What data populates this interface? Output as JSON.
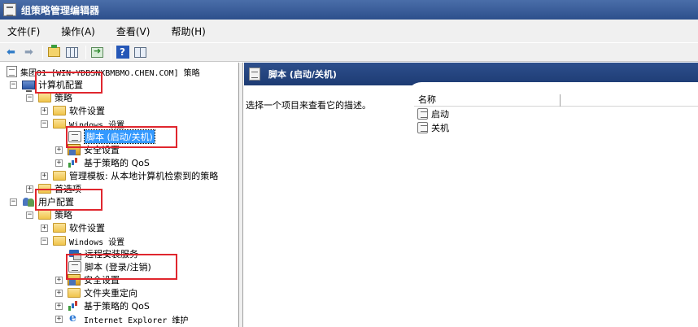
{
  "window": {
    "title": "组策略管理编辑器"
  },
  "menu": [
    {
      "label": "文件(F)"
    },
    {
      "label": "操作(A)"
    },
    {
      "label": "查看(V)"
    },
    {
      "label": "帮助(H)"
    }
  ],
  "toolbar": {
    "buttons": [
      "back-icon",
      "forward-icon",
      "up-folder-icon",
      "show-hide-tree-icon",
      "export-list-icon",
      "help-icon",
      "show-hide-action-pane-icon"
    ]
  },
  "tree": {
    "root": "集团01 [WIN-YDBSNXBMBMO.CHEN.COM] 策略",
    "computer_config": "计算机配置",
    "computer_policies": "策略",
    "computer_software": "软件设置",
    "computer_windows": "Windows 设置",
    "computer_scripts": "脚本 (启动/关机)",
    "computer_security": "安全设置",
    "computer_qos": "基于策略的 QoS",
    "computer_admin_templates": "管理模板: 从本地计算机检索到的策略",
    "computer_preferences": "首选项",
    "user_config": "用户配置",
    "user_policies": "策略",
    "user_software": "软件设置",
    "user_windows": "Windows 设置",
    "user_remote_install": "远程安装服务",
    "user_scripts": "脚本 (登录/注销)",
    "user_security": "安全设置",
    "user_folder_redirection": "文件夹重定向",
    "user_qos": "基于策略的 QoS",
    "user_ie": "Internet Explorer 维护"
  },
  "toggles": {
    "expanded": "−",
    "collapsed": "+"
  },
  "right": {
    "header": "脚本 (启动/关机)",
    "description": "选择一个项目来查看它的描述。",
    "column_name": "名称",
    "items": [
      {
        "label": "启动"
      },
      {
        "label": "关机"
      }
    ]
  },
  "colors": {
    "title_bar": "#2d4f8c",
    "header_bar": "#1d3b73",
    "selection": "#3399ff",
    "highlight_box": "#e0262e"
  }
}
